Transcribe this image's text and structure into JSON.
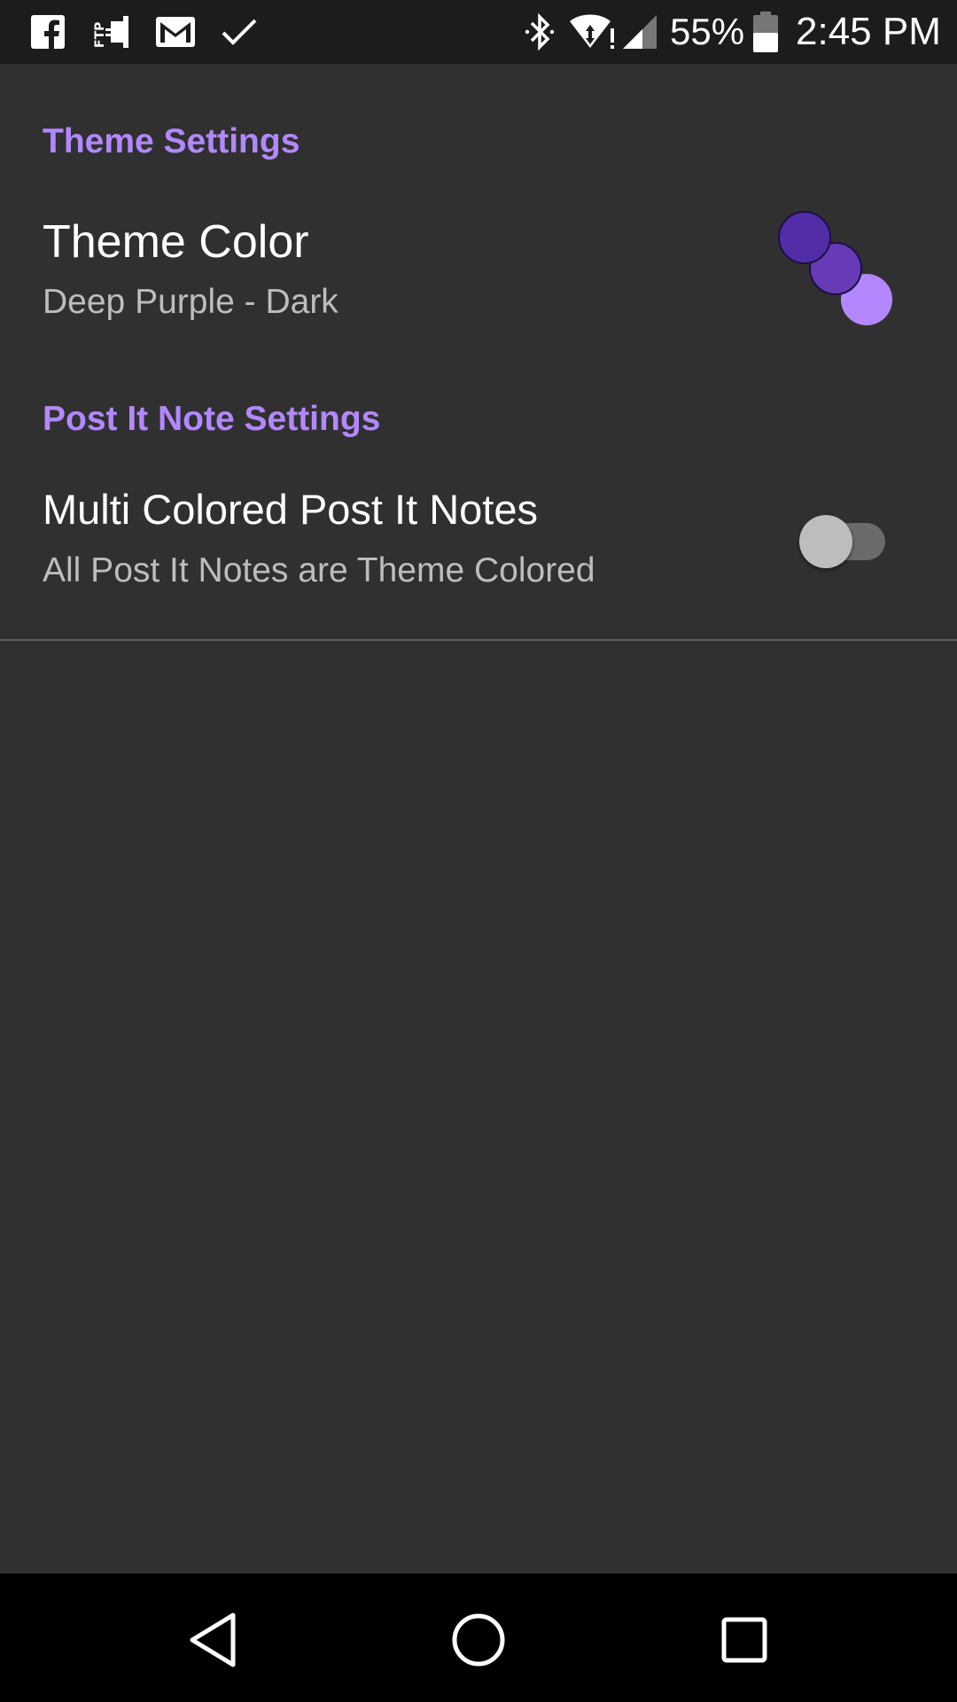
{
  "status_bar": {
    "notification_icons": [
      "facebook-icon",
      "ftp-icon",
      "gmail-icon",
      "check-icon"
    ],
    "system_icons": [
      "bluetooth-icon",
      "wifi-icon",
      "cell-signal-icon",
      "battery-icon"
    ],
    "battery_percent": "55%",
    "time": "2:45 PM"
  },
  "sections": {
    "theme": {
      "header": "Theme Settings",
      "theme_color": {
        "title": "Theme Color",
        "summary": "Deep Purple - Dark",
        "swatches": [
          "#512da8",
          "#673ab7",
          "#b388ff"
        ]
      }
    },
    "post_it": {
      "header": "Post It Note Settings",
      "multi_colored": {
        "title": "Multi Colored Post It Notes",
        "summary": "All Post It Notes are Theme Colored",
        "enabled": false
      }
    }
  },
  "nav_bar": {
    "buttons": [
      "back-icon",
      "home-icon",
      "recents-icon"
    ]
  },
  "colors": {
    "accent": "#b388ff",
    "background": "#303030",
    "status_bar": "#1c1c1c",
    "nav_bar": "#000000"
  }
}
